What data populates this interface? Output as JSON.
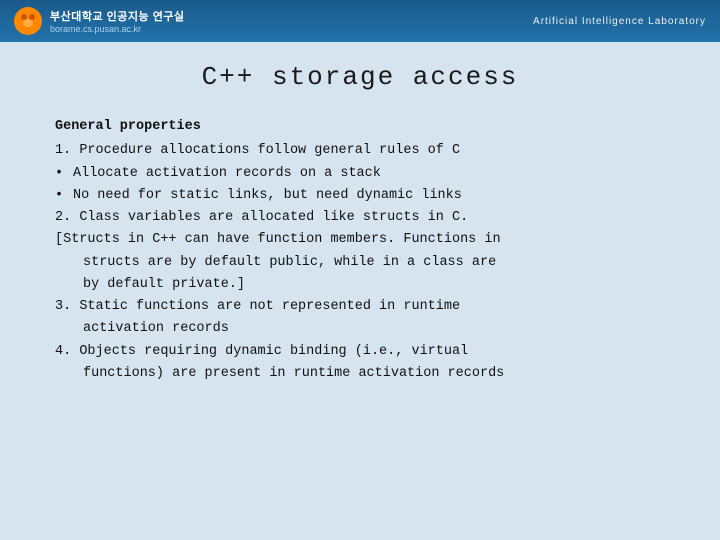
{
  "header": {
    "org_name": "부산대학교 인공지능 연구실",
    "url": "borame.cs.pusan.ac.kr",
    "lab_name": "Artificial Intelligence Laboratory"
  },
  "slide": {
    "title": "C++  storage  access",
    "lines": [
      {
        "type": "section",
        "text": "General properties"
      },
      {
        "type": "numbered",
        "num": "1.",
        "text": "Procedure allocations follow general rules of C"
      },
      {
        "type": "bullet",
        "text": "Allocate activation records on a stack"
      },
      {
        "type": "bullet",
        "text": "No need for static links, but need dynamic links"
      },
      {
        "type": "numbered",
        "num": "2.",
        "text": "Class variables are allocated like structs in C."
      },
      {
        "type": "bracket-open",
        "text": "[Structs in C++ can have function members. Functions in"
      },
      {
        "type": "bracket-indent",
        "text": "structs are by default public, while in a class are"
      },
      {
        "type": "bracket-indent",
        "text": "by default private.]"
      },
      {
        "type": "numbered",
        "num": "3.",
        "text": "Static functions are not represented in runtime"
      },
      {
        "type": "continuation",
        "text": "activation records"
      },
      {
        "type": "numbered",
        "num": "4.",
        "text": "Objects requiring dynamic binding (i.e., virtual"
      },
      {
        "type": "continuation",
        "text": "functions) are present in runtime activation records"
      }
    ]
  }
}
